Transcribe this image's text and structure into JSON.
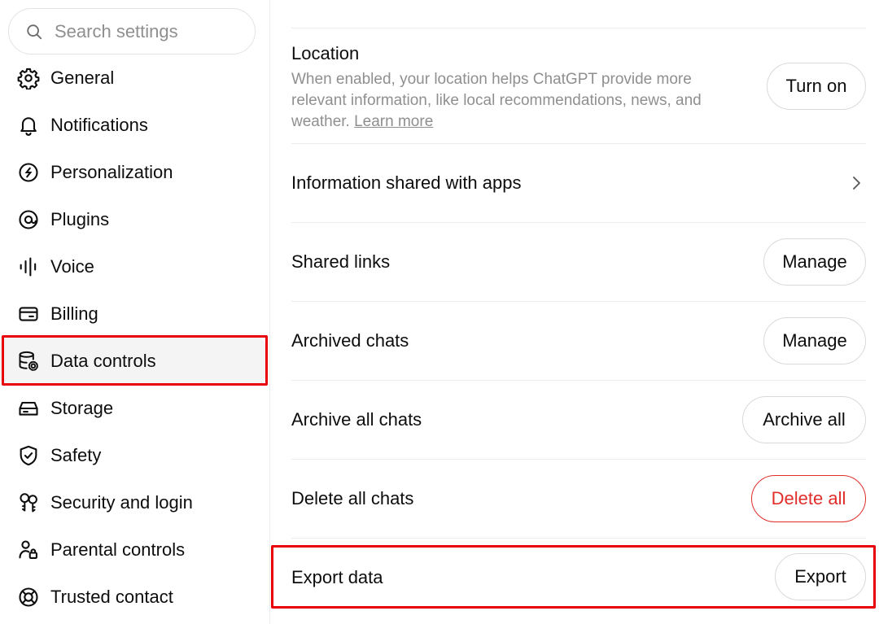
{
  "search": {
    "placeholder": "Search settings"
  },
  "sidebar": {
    "items": [
      {
        "label": "General",
        "icon": "gear-icon"
      },
      {
        "label": "Notifications",
        "icon": "bell-icon"
      },
      {
        "label": "Personalization",
        "icon": "personalization-icon"
      },
      {
        "label": "Plugins",
        "icon": "plugins-icon"
      },
      {
        "label": "Voice",
        "icon": "waveform-icon"
      },
      {
        "label": "Billing",
        "icon": "credit-card-icon"
      },
      {
        "label": "Data controls",
        "icon": "database-gear-icon",
        "active": true
      },
      {
        "label": "Storage",
        "icon": "storage-icon"
      },
      {
        "label": "Safety",
        "icon": "shield-check-icon"
      },
      {
        "label": "Security and login",
        "icon": "keys-icon"
      },
      {
        "label": "Parental controls",
        "icon": "parental-icon"
      },
      {
        "label": "Trusted contact",
        "icon": "lifebuoy-icon"
      }
    ]
  },
  "main": {
    "location": {
      "title": "Location",
      "description": "When enabled, your location helps ChatGPT provide more relevant information, like local recommendations, news, and weather.",
      "link": "Learn more",
      "button": "Turn on"
    },
    "info_apps": {
      "title": "Information shared with apps"
    },
    "shared_links": {
      "title": "Shared links",
      "button": "Manage"
    },
    "archived_chats": {
      "title": "Archived chats",
      "button": "Manage"
    },
    "archive_all": {
      "title": "Archive all chats",
      "button": "Archive all"
    },
    "delete_all": {
      "title": "Delete all chats",
      "button": "Delete all"
    },
    "export": {
      "title": "Export data",
      "button": "Export"
    }
  },
  "colors": {
    "danger": "#e02e2a",
    "highlight": "#e8000b",
    "active_bg": "#f4f4f4",
    "muted": "#8f8f8f"
  }
}
